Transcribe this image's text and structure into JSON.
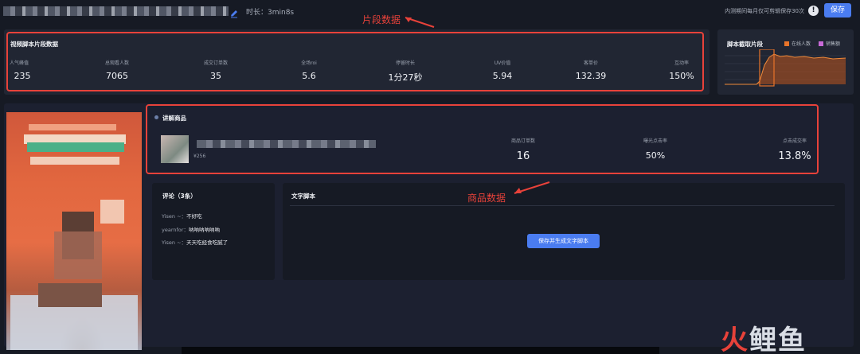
{
  "header": {
    "duration": "时长：3min8s",
    "notice": "内测期间每月仅可剪辑保存30次",
    "save_label": "保存"
  },
  "annotations": {
    "segment_data": "片段数据",
    "product_data": "商品数据"
  },
  "segment": {
    "title": "视频脚本片段数据",
    "metrics": [
      {
        "label": "人气峰值",
        "value": "235"
      },
      {
        "label": "总观看人数",
        "value": "7065"
      },
      {
        "label": "成交订单数",
        "value": "35"
      },
      {
        "label": "全场roi",
        "value": "5.6"
      },
      {
        "label": "停留时长",
        "value": "1分27秒"
      },
      {
        "label": "UV价值",
        "value": "5.94"
      },
      {
        "label": "客单价",
        "value": "132.39"
      },
      {
        "label": "互动率",
        "value": "150%"
      }
    ]
  },
  "mini_chart": {
    "title": "脚本截取片段",
    "legend": [
      {
        "name": "在线人数",
        "color": "#e8742a"
      },
      {
        "name": "销售额",
        "color": "#c86ad8"
      }
    ]
  },
  "product": {
    "title": "讲解商品",
    "price": "¥256",
    "metrics": [
      {
        "label": "商品订单数",
        "value": "16"
      },
      {
        "label": "曝光点击率",
        "value": "50%"
      },
      {
        "label": "点击成交率",
        "value": "13.8%"
      }
    ]
  },
  "comments": {
    "title": "评论（3条）",
    "items": [
      {
        "user": "Yisen ~：",
        "text": "不好吃"
      },
      {
        "user": "yearnfor：",
        "text": "呐呐呐呐呐呐"
      },
      {
        "user": "Yisen ~：",
        "text": "天天吃经食吃腻了"
      }
    ]
  },
  "script": {
    "title": "文字脚本",
    "button_label": "保存并生成文字脚本"
  },
  "watermark": {
    "part1": "火",
    "part2": "鲤鱼"
  }
}
